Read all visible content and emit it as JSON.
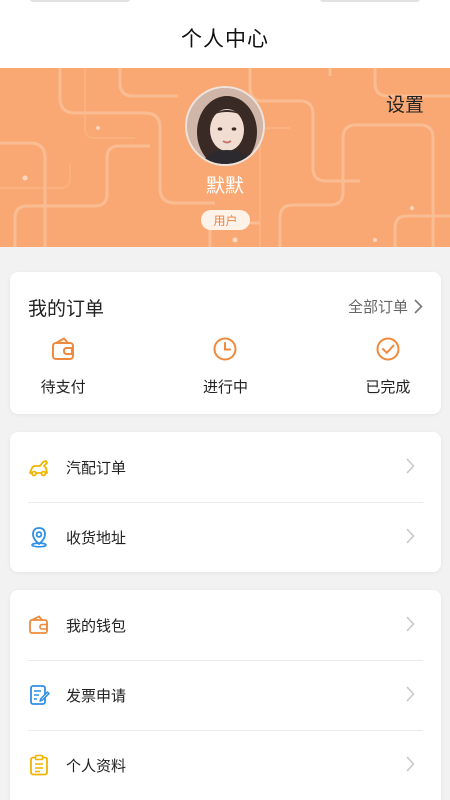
{
  "header": {
    "title": "个人中心"
  },
  "profile": {
    "settings_label": "设置",
    "username": "默默",
    "role": "用户"
  },
  "orders": {
    "title": "我的订单",
    "all_label": "全部订单",
    "items": [
      {
        "label": "待支付",
        "icon": "wallet-icon"
      },
      {
        "label": "进行中",
        "icon": "clock-icon"
      },
      {
        "label": "已完成",
        "icon": "check-circle-icon"
      }
    ]
  },
  "menu_group_1": [
    {
      "label": "汽配订单",
      "icon": "car-icon"
    },
    {
      "label": "收货地址",
      "icon": "location-icon"
    }
  ],
  "menu_group_2": [
    {
      "label": "我的钱包",
      "icon": "wallet-icon"
    },
    {
      "label": "发票申请",
      "icon": "invoice-edit-icon"
    },
    {
      "label": "个人资料",
      "icon": "clipboard-icon"
    }
  ],
  "colors": {
    "banner": "#f9a873",
    "accent": "#ef8a3c",
    "blue": "#2f8ee6",
    "yellow": "#f0b400"
  }
}
